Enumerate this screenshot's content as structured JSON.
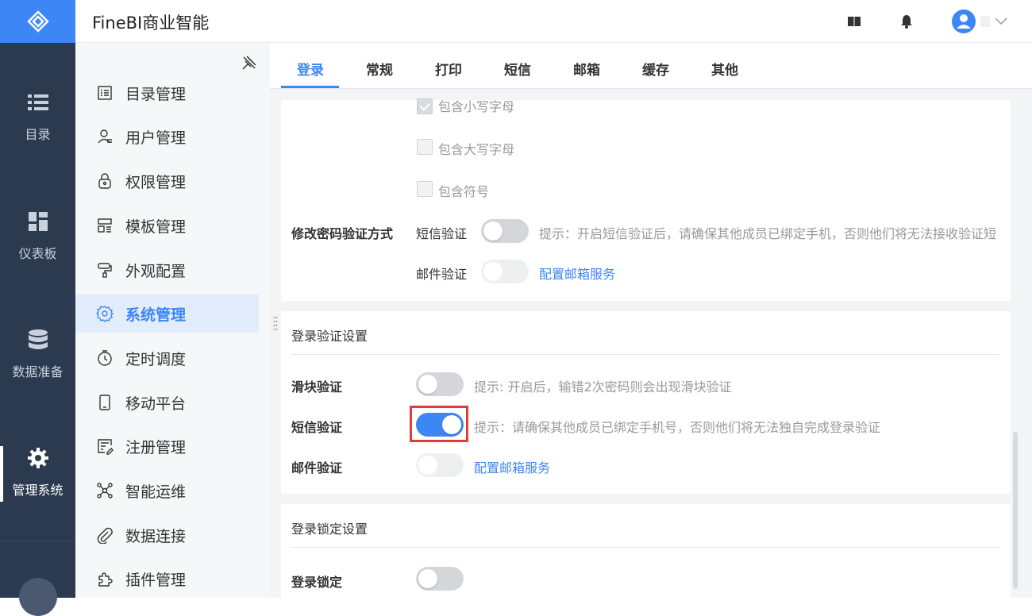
{
  "app": {
    "title": "FineBI商业智能"
  },
  "rail": {
    "items": [
      {
        "label": "目录",
        "icon": "list-icon"
      },
      {
        "label": "仪表板",
        "icon": "dashboard-icon"
      },
      {
        "label": "数据准备",
        "icon": "database-icon"
      },
      {
        "label": "管理系统",
        "icon": "gear-icon",
        "active": true
      }
    ]
  },
  "header": {
    "icons": [
      "book-icon",
      "bell-icon",
      "user-avatar-icon",
      "chevron-down-icon"
    ]
  },
  "submenu": {
    "items": [
      {
        "label": "目录管理",
        "icon": "catalog-icon"
      },
      {
        "label": "用户管理",
        "icon": "user-icon"
      },
      {
        "label": "权限管理",
        "icon": "lock-icon"
      },
      {
        "label": "模板管理",
        "icon": "template-icon"
      },
      {
        "label": "外观配置",
        "icon": "paint-roller-icon"
      },
      {
        "label": "系统管理",
        "icon": "gear-icon",
        "active": true
      },
      {
        "label": "定时调度",
        "icon": "timer-icon"
      },
      {
        "label": "移动平台",
        "icon": "mobile-icon"
      },
      {
        "label": "注册管理",
        "icon": "register-icon"
      },
      {
        "label": "智能运维",
        "icon": "network-icon"
      },
      {
        "label": "数据连接",
        "icon": "paperclip-icon"
      },
      {
        "label": "插件管理",
        "icon": "plugin-icon"
      }
    ]
  },
  "tabs": [
    "登录",
    "常规",
    "打印",
    "短信",
    "邮箱",
    "缓存",
    "其他"
  ],
  "active_tab": "登录",
  "password": {
    "checkboxes": [
      {
        "label": "包含小写字母",
        "checked": true
      },
      {
        "label": "包含大写字母",
        "checked": false
      },
      {
        "label": "包含符号",
        "checked": false
      }
    ],
    "change_verify": {
      "label": "修改密码验证方式",
      "sms_label": "短信验证",
      "sms_on": false,
      "sms_hint": "提示：开启短信验证后，请确保其他成员已绑定手机，否则他们将无法接收验证短",
      "email_label": "邮件验证",
      "email_on": false,
      "email_link": "配置邮箱服务"
    }
  },
  "login_verify": {
    "title": "登录验证设置",
    "slider_label": "滑块验证",
    "slider_on": false,
    "slider_hint": "提示: 开启后，输错2次密码则会出现滑块验证",
    "sms_label": "短信验证",
    "sms_on": true,
    "sms_hint": "提示：请确保其他成员已绑定手机号，否则他们将无法独自完成登录验证",
    "email_label": "邮件验证",
    "email_on": false,
    "email_link": "配置邮箱服务"
  },
  "login_lock": {
    "title": "登录锁定设置",
    "lock_label": "登录锁定",
    "lock_on": false
  },
  "colors": {
    "accent": "#3d86f5",
    "rail": "#2b3a4f",
    "highlight": "#e33b3b"
  }
}
